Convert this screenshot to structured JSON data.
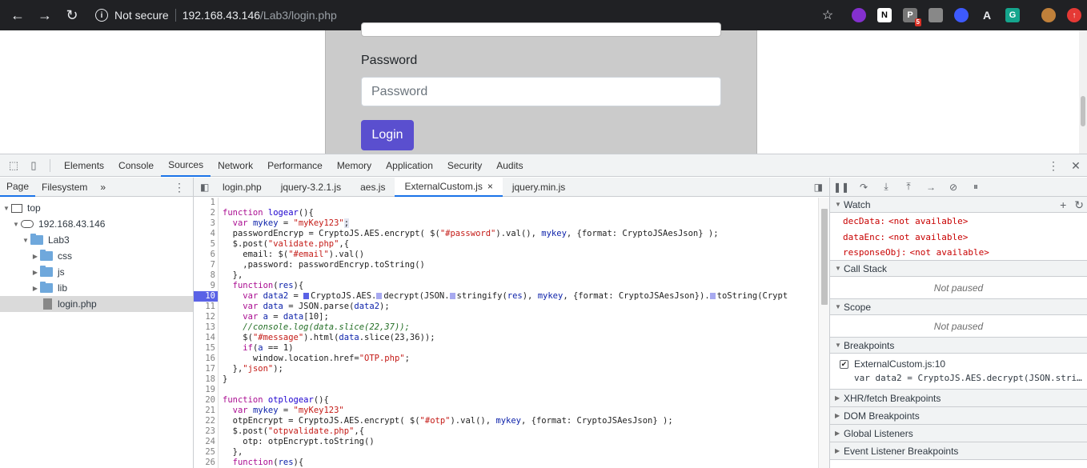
{
  "browser": {
    "back_icon": "←",
    "forward_icon": "→",
    "reload_icon": "↻",
    "security_label": "Not secure",
    "url_host": "192.168.43.146",
    "url_path": "/Lab3/login.php",
    "star_icon": "☆",
    "extension_badge": "5"
  },
  "page": {
    "password_label": "Password",
    "password_placeholder": "Password",
    "login_button": "Login"
  },
  "devtools": {
    "tabs": [
      "Elements",
      "Console",
      "Sources",
      "Network",
      "Performance",
      "Memory",
      "Application",
      "Security",
      "Audits"
    ],
    "active_tab": "Sources",
    "navigator": {
      "tabs": [
        "Page",
        "Filesystem"
      ],
      "more": "»",
      "tree": [
        {
          "label": "top"
        },
        {
          "label": "192.168.43.146"
        },
        {
          "label": "Lab3"
        },
        {
          "label": "css"
        },
        {
          "label": "js"
        },
        {
          "label": "lib"
        },
        {
          "label": "login.php"
        }
      ]
    },
    "editor": {
      "tabs": [
        {
          "label": "login.php"
        },
        {
          "label": "jquery-3.2.1.js"
        },
        {
          "label": "aes.js"
        },
        {
          "label": "ExternalCustom.js",
          "close": "×"
        },
        {
          "label": "jquery.min.js"
        }
      ],
      "line_numbers": [
        "1",
        "2",
        "3",
        "4",
        "5",
        "6",
        "7",
        "8",
        "9",
        "10",
        "11",
        "12",
        "13",
        "14",
        "15",
        "16",
        "17",
        "18",
        "19",
        "20",
        "21",
        "22",
        "23",
        "24",
        "25",
        "26"
      ],
      "breakpoint_line": "10"
    },
    "sidebar": {
      "watch_title": "Watch",
      "watch": [
        {
          "name": "decData:",
          "value": "<not available>"
        },
        {
          "name": "dataEnc:",
          "value": "<not available>"
        },
        {
          "name": "responseObj:",
          "value": "<not available>"
        }
      ],
      "call_stack_title": "Call Stack",
      "call_stack_status": "Not paused",
      "scope_title": "Scope",
      "scope_status": "Not paused",
      "breakpoints_title": "Breakpoints",
      "breakpoint_file": "ExternalCustom.js:10",
      "breakpoint_code": "var data2 = CryptoJS.AES.decrypt(JSON.stri…",
      "xhr_title": "XHR/fetch Breakpoints",
      "dom_title": "DOM Breakpoints",
      "global_title": "Global Listeners",
      "event_title": "Event Listener Breakpoints"
    }
  }
}
